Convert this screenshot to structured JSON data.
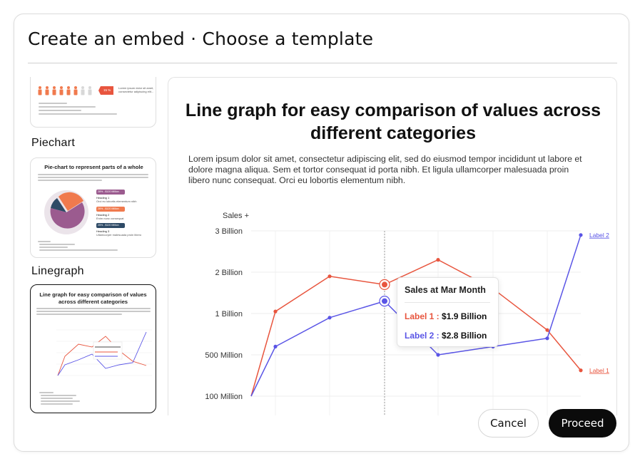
{
  "dialog": {
    "title": "Create an embed · Choose a template",
    "cancel_label": "Cancel",
    "proceed_label": "Proceed"
  },
  "rail": {
    "items": [
      {
        "label": "",
        "thumb_text": "Lorem ipsum dolor sit amet, consectetur adipiscing elit...",
        "badge": "15 %"
      },
      {
        "label": "Piechart",
        "thumb_title": "Pie-chart to represent parts of a whole",
        "legend": [
          {
            "chip": "28% - $120 Million",
            "heading": "Heading 1",
            "text": "Orci eu lobortis elementum nibh",
            "color": "#9b5b8f"
          },
          {
            "chip": "26% - $120 Million",
            "heading": "Heading 2",
            "text": "Enim nunc consequat",
            "color": "#f07a4e"
          },
          {
            "chip": "25% - $120 Million",
            "heading": "Heading 3",
            "text": "Ullamcorper malesuada proin libero",
            "color": "#2e4a66"
          }
        ]
      },
      {
        "label": "Linegraph",
        "thumb_title": "Line graph for easy comparison of values across different categories"
      }
    ]
  },
  "preview": {
    "title": "Line graph for easy comparison of values across different categories",
    "description": "Lorem ipsum dolor sit amet, consectetur adipiscing elit, sed do eiusmod tempor incididunt ut labore et dolore magna aliqua. Sem et tortor consequat id porta nibh. Et ligula ullamcorper malesuada proin libero nunc consequat. Orci eu lobortis elementum nibh.",
    "tooltip": {
      "heading": "Sales at Mar Month",
      "label1": "Label 1 :",
      "value1": "$1.9 Billion",
      "label2": "Label 2 :",
      "value2": "$2.8 Billion"
    }
  },
  "chart_data": {
    "type": "line",
    "ylabel": "Sales +",
    "y_ticks": [
      "3 Billion",
      "2 Billion",
      "1 Billion",
      "500 Million",
      "100 Million"
    ],
    "x": [
      0,
      1,
      2,
      3,
      4,
      5,
      6,
      7
    ],
    "series": [
      {
        "name": "Label 1",
        "color": "#e8553e",
        "values": [
          100,
          1050,
          1900,
          1700,
          2300,
          1600,
          800,
          350
        ]
      },
      {
        "name": "Label 2",
        "color": "#5a55e6",
        "values": [
          100,
          600,
          950,
          1300,
          500,
          600,
          700,
          2900
        ]
      }
    ],
    "highlight_index": 3,
    "colors": {
      "label1": "#e8553e",
      "label2": "#5a55e6",
      "grid": "#ececec"
    }
  }
}
